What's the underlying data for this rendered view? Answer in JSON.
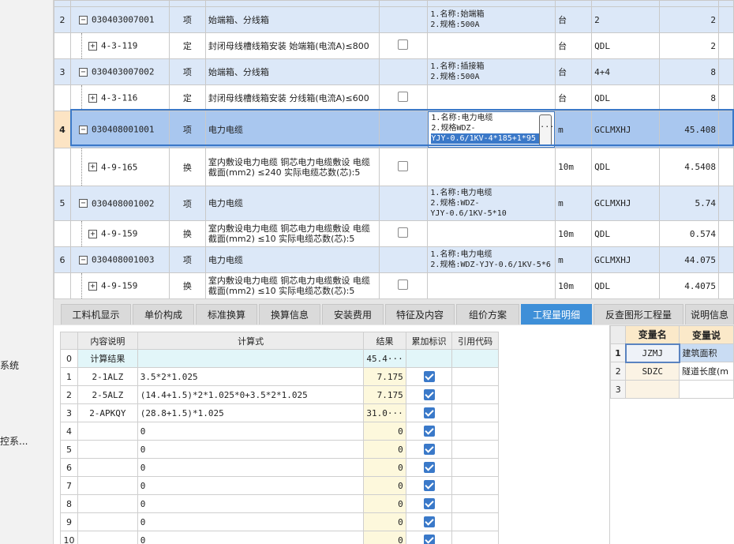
{
  "sidebar": {
    "items": [
      {
        "label": "系统"
      },
      {
        "label": "控系..."
      }
    ]
  },
  "main_grid": {
    "rows": [
      {
        "no": "2",
        "code": "030403007001",
        "tree_box": "−",
        "type": "项",
        "name": "始端箱、分线箱",
        "has_checkbox": false,
        "feature": "1.名称:始端箱\n2.规格:500A",
        "unit": "台",
        "expr": "2",
        "qty": "2",
        "kind": "item"
      },
      {
        "no": "",
        "code": "4-3-119",
        "tree_box": "+",
        "type": "定",
        "name": "封闭母线槽线箱安装 始端箱(电流A)≤800",
        "has_checkbox": true,
        "feature": "",
        "unit": "台",
        "expr": "QDL",
        "qty": "2",
        "kind": "sub"
      },
      {
        "no": "3",
        "code": "030403007002",
        "tree_box": "−",
        "type": "项",
        "name": "始端箱、分线箱",
        "has_checkbox": false,
        "feature": "1.名称:插接箱\n2.规格:500A",
        "unit": "台",
        "expr": "4+4",
        "qty": "8",
        "kind": "item"
      },
      {
        "no": "",
        "code": "4-3-116",
        "tree_box": "+",
        "type": "定",
        "name": "封闭母线槽线箱安装 分线箱(电流A)≤600",
        "has_checkbox": true,
        "feature": "",
        "unit": "台",
        "expr": "QDL",
        "qty": "8",
        "kind": "sub"
      },
      {
        "no": "4",
        "code": "030408001001",
        "tree_box": "−",
        "type": "项",
        "name": "电力电缆",
        "has_checkbox": false,
        "feature_lines": [
          "1.名称:电力电缆",
          "2.规格WDZ-",
          "YJY-0.6/1KV-4*185+1*95"
        ],
        "unit": "m",
        "expr": "GCLMXHJ",
        "qty": "45.408",
        "kind": "sel"
      },
      {
        "no": "",
        "code": "4-9-165",
        "tree_box": "+",
        "type": "换",
        "name": "室内敷设电力电缆 铜芯电力电缆敷设 电缆截面(mm2) ≤240 实际电缆芯数(芯):5",
        "has_checkbox": true,
        "feature": "",
        "unit": "10m",
        "expr": "QDL",
        "qty": "4.5408",
        "kind": "sub"
      },
      {
        "no": "5",
        "code": "030408001002",
        "tree_box": "−",
        "type": "项",
        "name": "电力电缆",
        "has_checkbox": false,
        "feature": "1.名称:电力电缆\n2.规格:WDZ-\nYJY-0.6/1KV-5*10",
        "unit": "m",
        "expr": "GCLMXHJ",
        "qty": "5.74",
        "kind": "item"
      },
      {
        "no": "",
        "code": "4-9-159",
        "tree_box": "+",
        "type": "换",
        "name": "室内敷设电力电缆 铜芯电力电缆敷设 电缆截面(mm2) ≤10 实际电缆芯数(芯):5",
        "has_checkbox": true,
        "feature": "",
        "unit": "10m",
        "expr": "QDL",
        "qty": "0.574",
        "kind": "sub"
      },
      {
        "no": "6",
        "code": "030408001003",
        "tree_box": "−",
        "type": "项",
        "name": "电力电缆",
        "has_checkbox": false,
        "feature": "1.名称:电力电缆\n2.规格:WDZ-YJY-0.6/1KV-5*6",
        "unit": "m",
        "expr": "GCLMXHJ",
        "qty": "44.075",
        "kind": "item"
      },
      {
        "no": "",
        "code": "4-9-159",
        "tree_box": "+",
        "type": "换",
        "name": "室内敷设电力电缆 铜芯电力电缆敷设 电缆截面(mm2) ≤10 实际电缆芯数(芯):5",
        "has_checkbox": true,
        "feature": "",
        "unit": "10m",
        "expr": "QDL",
        "qty": "4.4075",
        "kind": "sub"
      }
    ],
    "ellipsis": "..."
  },
  "tabs": [
    {
      "label": "工料机显示",
      "active": false
    },
    {
      "label": "单价构成",
      "active": false
    },
    {
      "label": "标准换算",
      "active": false
    },
    {
      "label": "换算信息",
      "active": false
    },
    {
      "label": "安装费用",
      "active": false
    },
    {
      "label": "特征及内容",
      "active": false
    },
    {
      "label": "组价方案",
      "active": false
    },
    {
      "label": "工程量明细",
      "active": true
    },
    {
      "label": "反查图形工程量",
      "active": false
    },
    {
      "label": "说明信息",
      "active": false
    }
  ],
  "calc_table": {
    "headers": [
      "内容说明",
      "计算式",
      "结果",
      "累加标识",
      "引用代码"
    ],
    "rows": [
      {
        "no": "0",
        "desc": "计算结果",
        "formula": "",
        "result": "45.4···",
        "checked": false,
        "ref": ""
      },
      {
        "no": "1",
        "desc": "2-1ALZ",
        "formula": "3.5*2*1.025",
        "result": "7.175",
        "checked": true,
        "ref": ""
      },
      {
        "no": "2",
        "desc": "2-5ALZ",
        "formula": "(14.4+1.5)*2*1.025*0+3.5*2*1.025",
        "result": "7.175",
        "checked": true,
        "ref": ""
      },
      {
        "no": "3",
        "desc": "2-APKQY",
        "formula": "(28.8+1.5)*1.025",
        "result": "31.0···",
        "checked": true,
        "ref": ""
      },
      {
        "no": "4",
        "desc": "",
        "formula": "0",
        "result": "0",
        "checked": true,
        "ref": ""
      },
      {
        "no": "5",
        "desc": "",
        "formula": "0",
        "result": "0",
        "checked": true,
        "ref": ""
      },
      {
        "no": "6",
        "desc": "",
        "formula": "0",
        "result": "0",
        "checked": true,
        "ref": ""
      },
      {
        "no": "7",
        "desc": "",
        "formula": "0",
        "result": "0",
        "checked": true,
        "ref": ""
      },
      {
        "no": "8",
        "desc": "",
        "formula": "0",
        "result": "0",
        "checked": true,
        "ref": ""
      },
      {
        "no": "9",
        "desc": "",
        "formula": "0",
        "result": "0",
        "checked": true,
        "ref": ""
      },
      {
        "no": "10",
        "desc": "",
        "formula": "0",
        "result": "0",
        "checked": true,
        "ref": ""
      }
    ]
  },
  "var_table": {
    "headers": [
      "变量名",
      "变量说"
    ],
    "rows": [
      {
        "no": "1",
        "name": "JZMJ",
        "desc": "建筑面积"
      },
      {
        "no": "2",
        "name": "SDZC",
        "desc": "隧道长度(m"
      },
      {
        "no": "3",
        "name": "",
        "desc": ""
      }
    ]
  },
  "colors": {
    "accent": "#3a78c8",
    "item_row": "#dce8f8",
    "selected_row": "#a9c7ef",
    "tab_active": "#3e8fd8",
    "check": "#3a79c9"
  }
}
